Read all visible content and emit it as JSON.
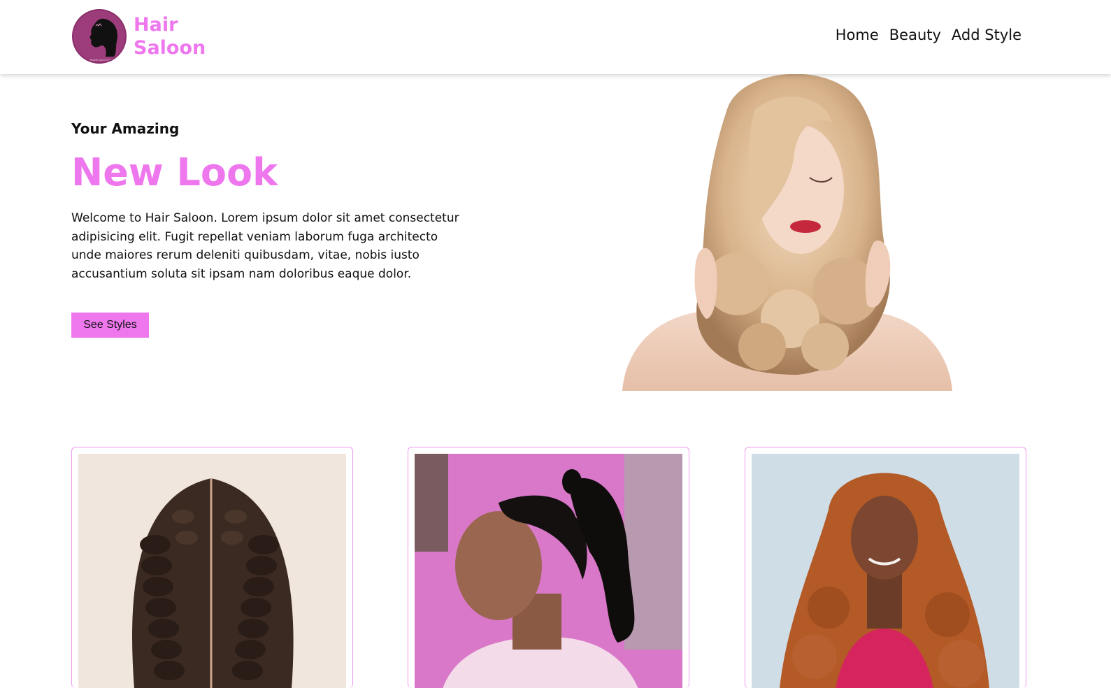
{
  "brand": {
    "line1": "Hair",
    "line2": "Saloon",
    "logo_caption": "HAIR SALOON",
    "accent": "#ee77ee"
  },
  "nav": {
    "items": [
      {
        "label": "Home"
      },
      {
        "label": "Beauty"
      },
      {
        "label": "Add Style"
      }
    ]
  },
  "hero": {
    "kicker": "Your Amazing",
    "title": "New Look",
    "text": "Welcome to Hair Saloon. Lorem ipsum dolor sit amet consectetur adipisicing elit. Fugit repellat veniam laborum fuga architecto unde maiores rerum deleniti quibusdam, vitae, nobis iusto accusantium soluta sit ipsam nam doloribus eaque dolor.",
    "button": "See Styles",
    "image": "woman-with-curly-blonde-hair"
  },
  "cards": [
    {
      "image": "braids-back-view"
    },
    {
      "image": "sleek-ponytail-side-view"
    },
    {
      "image": "long-auburn-waves"
    }
  ]
}
